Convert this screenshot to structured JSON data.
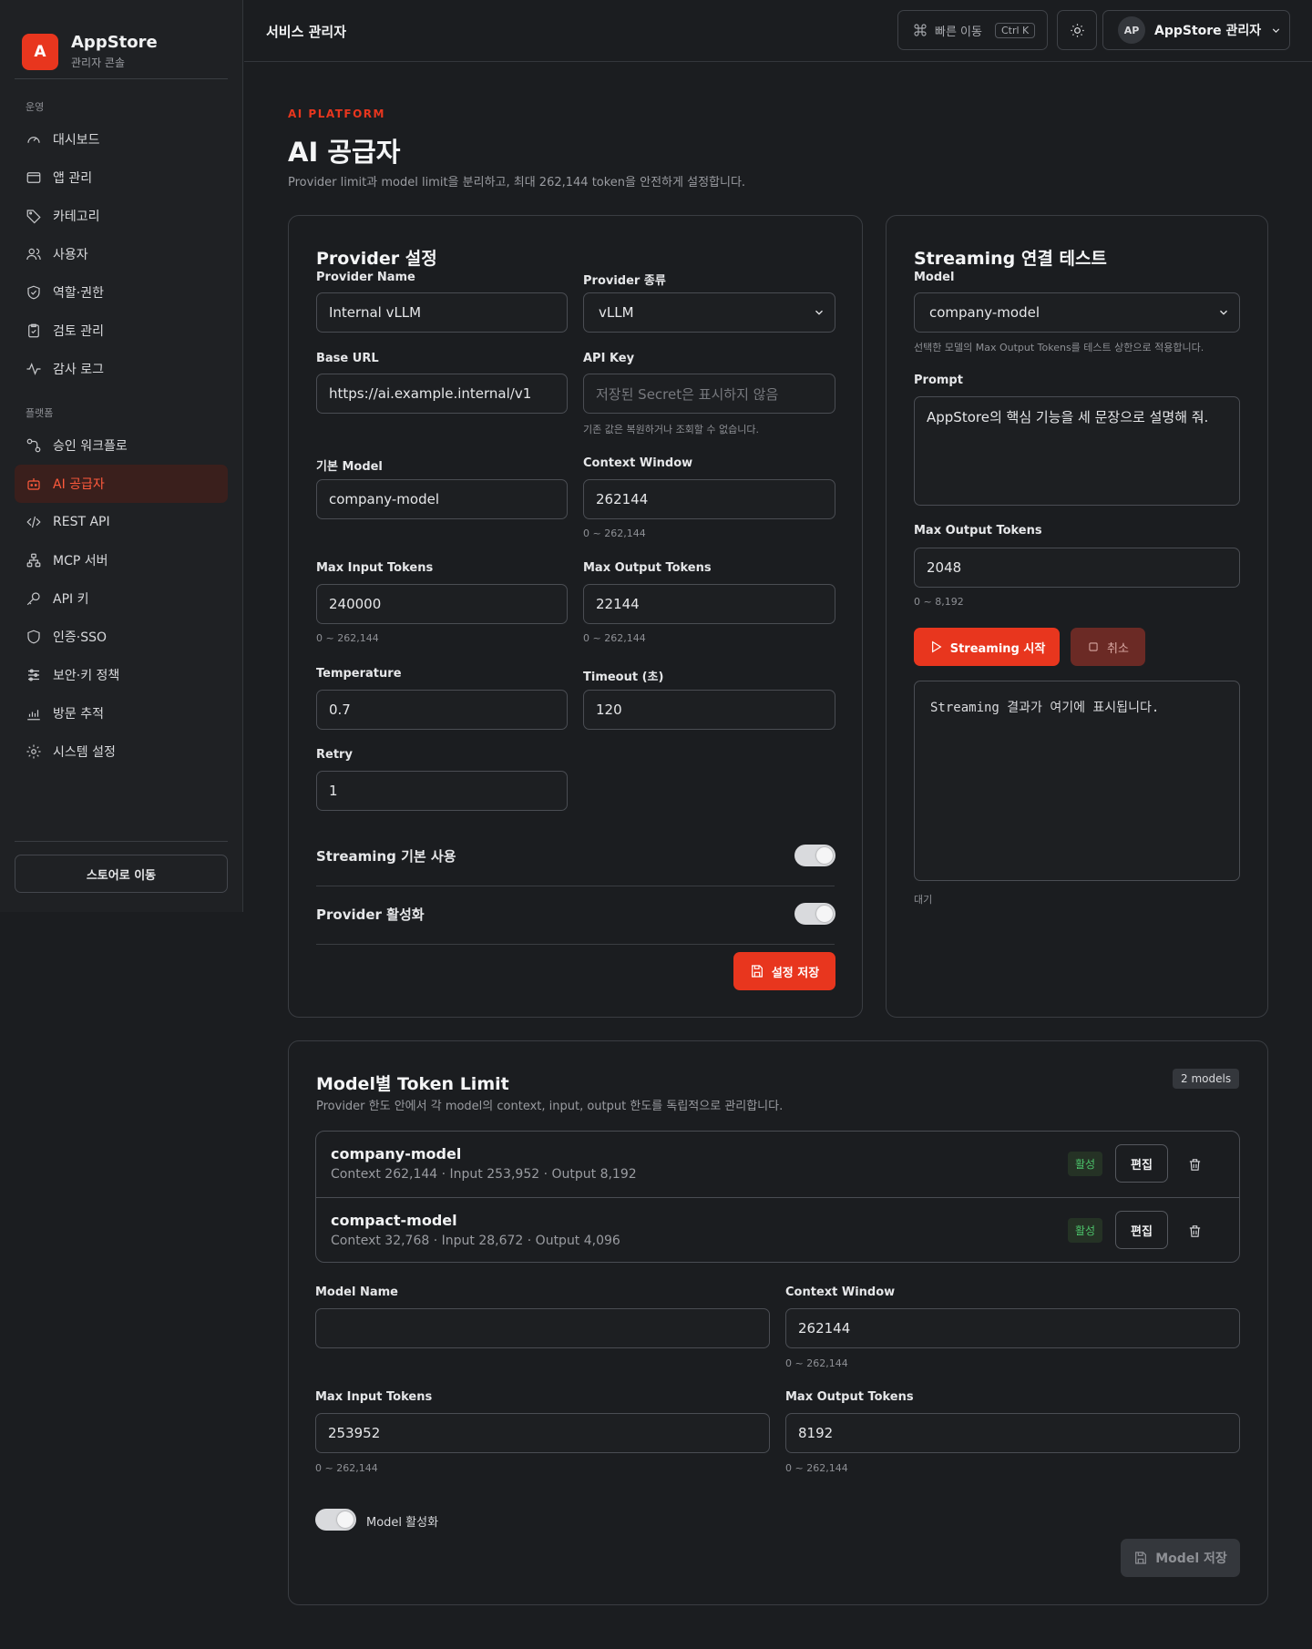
{
  "brand": {
    "logo_letter": "A",
    "name": "AppStore",
    "subtitle": "관리자 콘솔"
  },
  "sidebar": {
    "groups": [
      {
        "title": "운영",
        "items": [
          {
            "label": "대시보드",
            "icon": "gauge-icon"
          },
          {
            "label": "앱 관리",
            "icon": "window-icon"
          },
          {
            "label": "카테고리",
            "icon": "tag-icon"
          },
          {
            "label": "사용자",
            "icon": "users-icon"
          },
          {
            "label": "역할·권한",
            "icon": "shield-check-icon"
          },
          {
            "label": "검토 관리",
            "icon": "clipboard-check-icon"
          },
          {
            "label": "감사 로그",
            "icon": "activity-icon"
          }
        ]
      },
      {
        "title": "플랫폼",
        "items": [
          {
            "label": "승인 워크플로",
            "icon": "workflow-icon"
          },
          {
            "label": "AI 공급자",
            "icon": "bot-icon",
            "active": true
          },
          {
            "label": "REST API",
            "icon": "code-icon"
          },
          {
            "label": "MCP 서버",
            "icon": "network-icon"
          },
          {
            "label": "API 키",
            "icon": "key-icon"
          },
          {
            "label": "인증·SSO",
            "icon": "shield-icon"
          },
          {
            "label": "보안·키 정책",
            "icon": "sliders-icon"
          },
          {
            "label": "방문 추적",
            "icon": "chart-icon"
          },
          {
            "label": "시스템 설정",
            "icon": "gear-icon"
          }
        ]
      }
    ],
    "store_button": "스토어로 이동"
  },
  "header": {
    "title": "서비스 관리자",
    "quick_nav": "빠른 이동",
    "shortcut": "Ctrl K",
    "user_initials": "AP",
    "user_name": "AppStore 관리자"
  },
  "page": {
    "eyebrow": "AI PLATFORM",
    "title": "AI 공급자",
    "description": "Provider limit과 model limit을 분리하고, 최대 262,144 token을 안전하게 설정합니다."
  },
  "provider": {
    "title": "Provider 설정",
    "name_label": "Provider Name",
    "name_value": "Internal vLLM",
    "type_label": "Provider 종류",
    "type_value": "vLLM",
    "base_url_label": "Base URL",
    "base_url_value": "https://ai.example.internal/v1",
    "api_key_label": "API Key",
    "api_key_placeholder": "저장된 Secret은 표시하지 않음",
    "api_key_hint": "기존 값은 복원하거나 조회할 수 없습니다.",
    "model_label": "기본 Model",
    "model_value": "company-model",
    "context_label": "Context Window",
    "context_value": "262144",
    "context_hint": "0 ~ 262,144",
    "max_input_label": "Max Input Tokens",
    "max_input_value": "240000",
    "max_input_hint": "0 ~ 262,144",
    "max_output_label": "Max Output Tokens",
    "max_output_value": "22144",
    "max_output_hint": "0 ~ 262,144",
    "temperature_label": "Temperature",
    "temperature_value": "0.7",
    "timeout_label": "Timeout (초)",
    "timeout_value": "120",
    "retry_label": "Retry",
    "retry_value": "1",
    "streaming_label": "Streaming 기본 사용",
    "streaming_on": true,
    "active_label": "Provider 활성화",
    "active_on": true,
    "save_label": "설정 저장"
  },
  "streaming": {
    "title": "Streaming 연결 테스트",
    "model_label": "Model",
    "model_value": "company-model",
    "model_hint": "선택한 모델의 Max Output Tokens를 테스트 상한으로 적용합니다.",
    "prompt_label": "Prompt",
    "prompt_value": "AppStore의 핵심 기능을 세 문장으로 설명해 줘.",
    "max_output_label": "Max Output Tokens",
    "max_output_value": "2048",
    "max_output_hint": "0 ~ 8,192",
    "start_label": "Streaming 시작",
    "cancel_label": "취소",
    "output_placeholder": "Streaming 결과가 여기에 표시됩니다.",
    "status": "대기"
  },
  "models": {
    "title": "Model별 Token Limit",
    "description": "Provider 한도 안에서 각 model의 context, input, output 한도를 독립적으로 관리합니다.",
    "count_badge": "2 models",
    "rows": [
      {
        "name": "company-model",
        "meta": "Context 262,144 · Input 253,952 · Output 8,192",
        "status": "활성",
        "edit": "편집"
      },
      {
        "name": "compact-model",
        "meta": "Context 32,768 · Input 28,672 · Output 4,096",
        "status": "활성",
        "edit": "편집"
      }
    ],
    "form": {
      "name_label": "Model Name",
      "name_value": "",
      "context_label": "Context Window",
      "context_value": "262144",
      "context_hint": "0 ~ 262,144",
      "max_input_label": "Max Input Tokens",
      "max_input_value": "253952",
      "max_input_hint": "0 ~ 262,144",
      "max_output_label": "Max Output Tokens",
      "max_output_value": "8192",
      "max_output_hint": "0 ~ 262,144",
      "active_label": "Model 활성화",
      "active_on": true,
      "save_label": "Model 저장"
    }
  },
  "colors": {
    "accent": "#e8361e",
    "background": "#1b1d20",
    "sidebar": "#1f2124",
    "success": "#4cc36a"
  }
}
